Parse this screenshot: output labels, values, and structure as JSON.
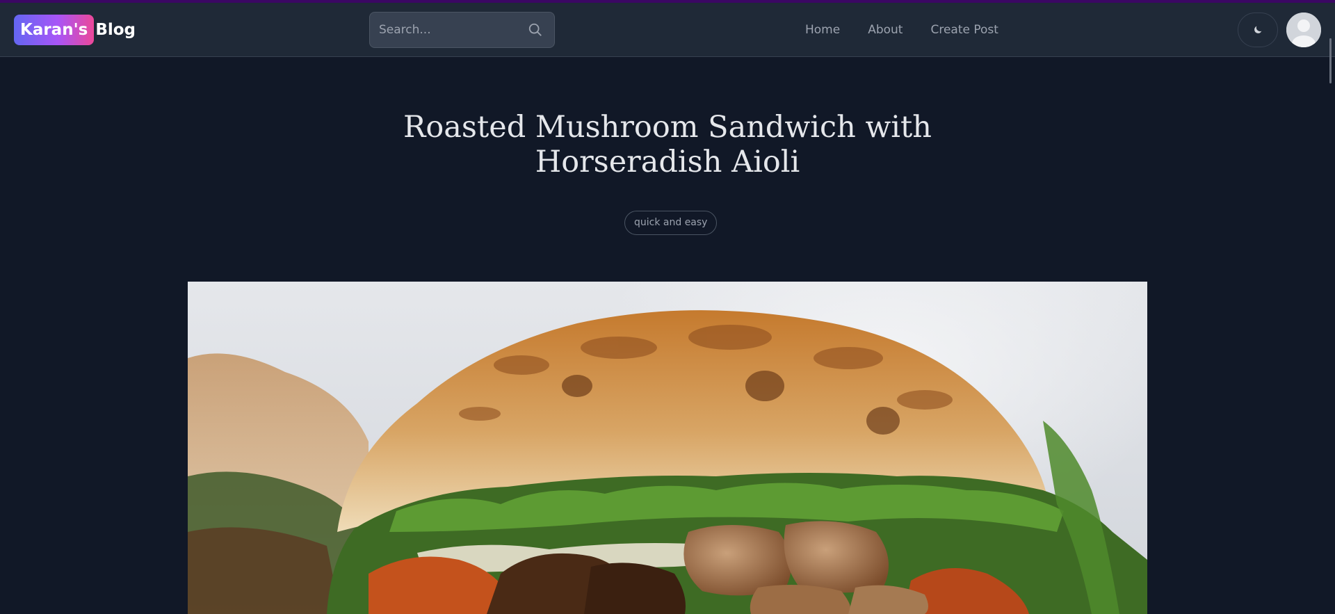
{
  "header": {
    "logo_badge": "Karan's",
    "logo_text": "Blog",
    "search_placeholder": "Search...",
    "nav": [
      "Home",
      "About",
      "Create Post"
    ],
    "theme_icon": "moon-icon",
    "avatar_icon": "user-avatar-icon"
  },
  "post": {
    "title": "Roasted Mushroom Sandwich with Horseradish Aioli",
    "tag": "quick and easy",
    "hero_image": "roasted-mushroom-sandwich-photo"
  },
  "colors": {
    "background": "#111827",
    "header": "#1f2937",
    "accent_gradient": [
      "#6366f1",
      "#ec4899"
    ]
  }
}
